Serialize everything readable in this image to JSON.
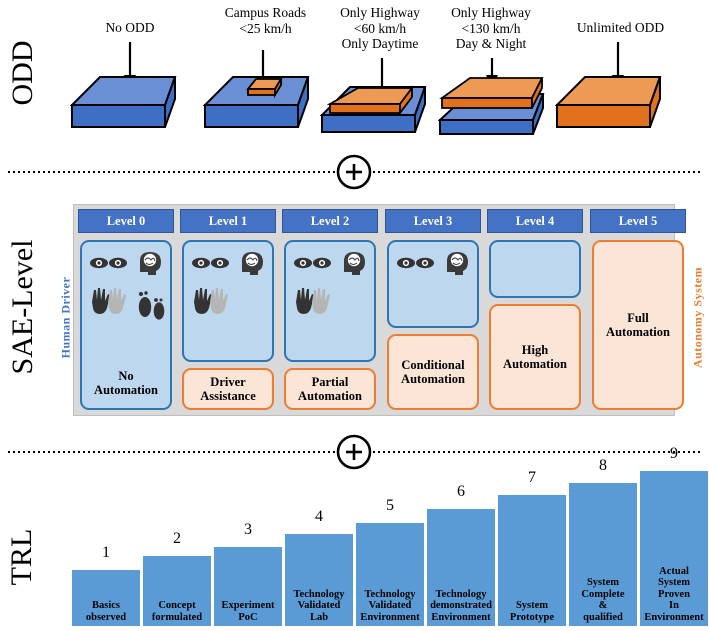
{
  "rows": {
    "odd_label": "ODD",
    "sae_label": "SAE-Level",
    "trl_label": "TRL"
  },
  "colors": {
    "blue_top": "#6b8fd4",
    "blue_side": "#3f6fc4",
    "blue_front": "#3f6fc4",
    "orange_top": "#ed9a55",
    "orange_side": "#e2711d",
    "header_blue": "#4472c4",
    "light_blue": "#bdd7ee",
    "light_orange": "#fbe5d6",
    "border_blue": "#2e75b6",
    "border_orange": "#ed7d31",
    "bar_blue": "#5b9bd5",
    "frame_grey": "#d9d9d9"
  },
  "odd": {
    "items": [
      {
        "caption": "No ODD",
        "type": "all-blue"
      },
      {
        "caption": "Campus Roads\n<25 km/h",
        "type": "small-orange-patch"
      },
      {
        "caption": "Only Highway\n<60 km/h\nOnly Daytime",
        "type": "medium-orange-layer"
      },
      {
        "caption": "Only Highway\n<130 km/h\nDay & Night",
        "type": "large-orange-layer"
      },
      {
        "caption": "Unlimited ODD",
        "type": "all-orange"
      }
    ]
  },
  "separators": [
    {
      "symbol": "+",
      "name": "plus-separator-odd-sae"
    },
    {
      "symbol": "+",
      "name": "plus-separator-sae-trl"
    }
  ],
  "sae": {
    "left_side_label": "Human Driver",
    "right_side_label": "Autonomy System",
    "levels": [
      {
        "header": "Level 0",
        "driver_box": {
          "label": "No\nAutomation",
          "style": "blue"
        },
        "system_box": null,
        "icons": [
          "eye-icon",
          "eye-icon",
          "brain-head-icon",
          "hands-icon",
          "feet-icon"
        ]
      },
      {
        "header": "Level 1",
        "driver_box": {
          "label": "",
          "style": "blue"
        },
        "system_box": {
          "label": "Driver\nAssistance",
          "style": "orange"
        },
        "icons": [
          "eye-icon",
          "eye-icon",
          "brain-head-icon",
          "hands-icon"
        ]
      },
      {
        "header": "Level 2",
        "driver_box": {
          "label": "",
          "style": "blue"
        },
        "system_box": {
          "label": "Partial\nAutomation",
          "style": "orange"
        },
        "icons": [
          "eye-icon",
          "eye-icon",
          "brain-head-icon",
          "hands-icon"
        ]
      },
      {
        "header": "Level 3",
        "driver_box": {
          "label": "",
          "style": "blue"
        },
        "system_box": {
          "label": "Conditional\nAutomation",
          "style": "orange"
        },
        "icons": [
          "eye-icon",
          "eye-icon",
          "brain-head-icon"
        ]
      },
      {
        "header": "Level 4",
        "driver_box": {
          "label": "",
          "style": "blue"
        },
        "system_box": {
          "label": "High\nAutomation",
          "style": "orange"
        },
        "icons": []
      },
      {
        "header": "Level 5",
        "driver_box": null,
        "system_box": {
          "label": "Full\nAutomation",
          "style": "orange"
        },
        "icons": []
      }
    ]
  },
  "chart_data": {
    "type": "bar",
    "title": "TRL",
    "xlabel": "",
    "ylabel": "",
    "categories": [
      "1",
      "2",
      "3",
      "4",
      "5",
      "6",
      "7",
      "8",
      "9"
    ],
    "values": [
      1,
      2,
      3,
      4,
      5,
      6,
      7,
      8,
      9
    ],
    "ylim": [
      0,
      9
    ],
    "grid": false,
    "legend": "none",
    "bar_labels": [
      "Basics\nobserved",
      "Concept\nformulated",
      "Experiment\nPoC",
      "Technology\nValidated\nLab",
      "Technology\nValidated\nEnvironment",
      "Technology\ndemonstrated\nEnvironment",
      "System\nPrototype",
      "System\nComplete\n&\nqualified",
      "Actual\nSystem\nProven\nIn\nEnvironment"
    ],
    "data_labels": [
      "1",
      "2",
      "3",
      "4",
      "5",
      "6",
      "7",
      "8",
      "9"
    ]
  }
}
